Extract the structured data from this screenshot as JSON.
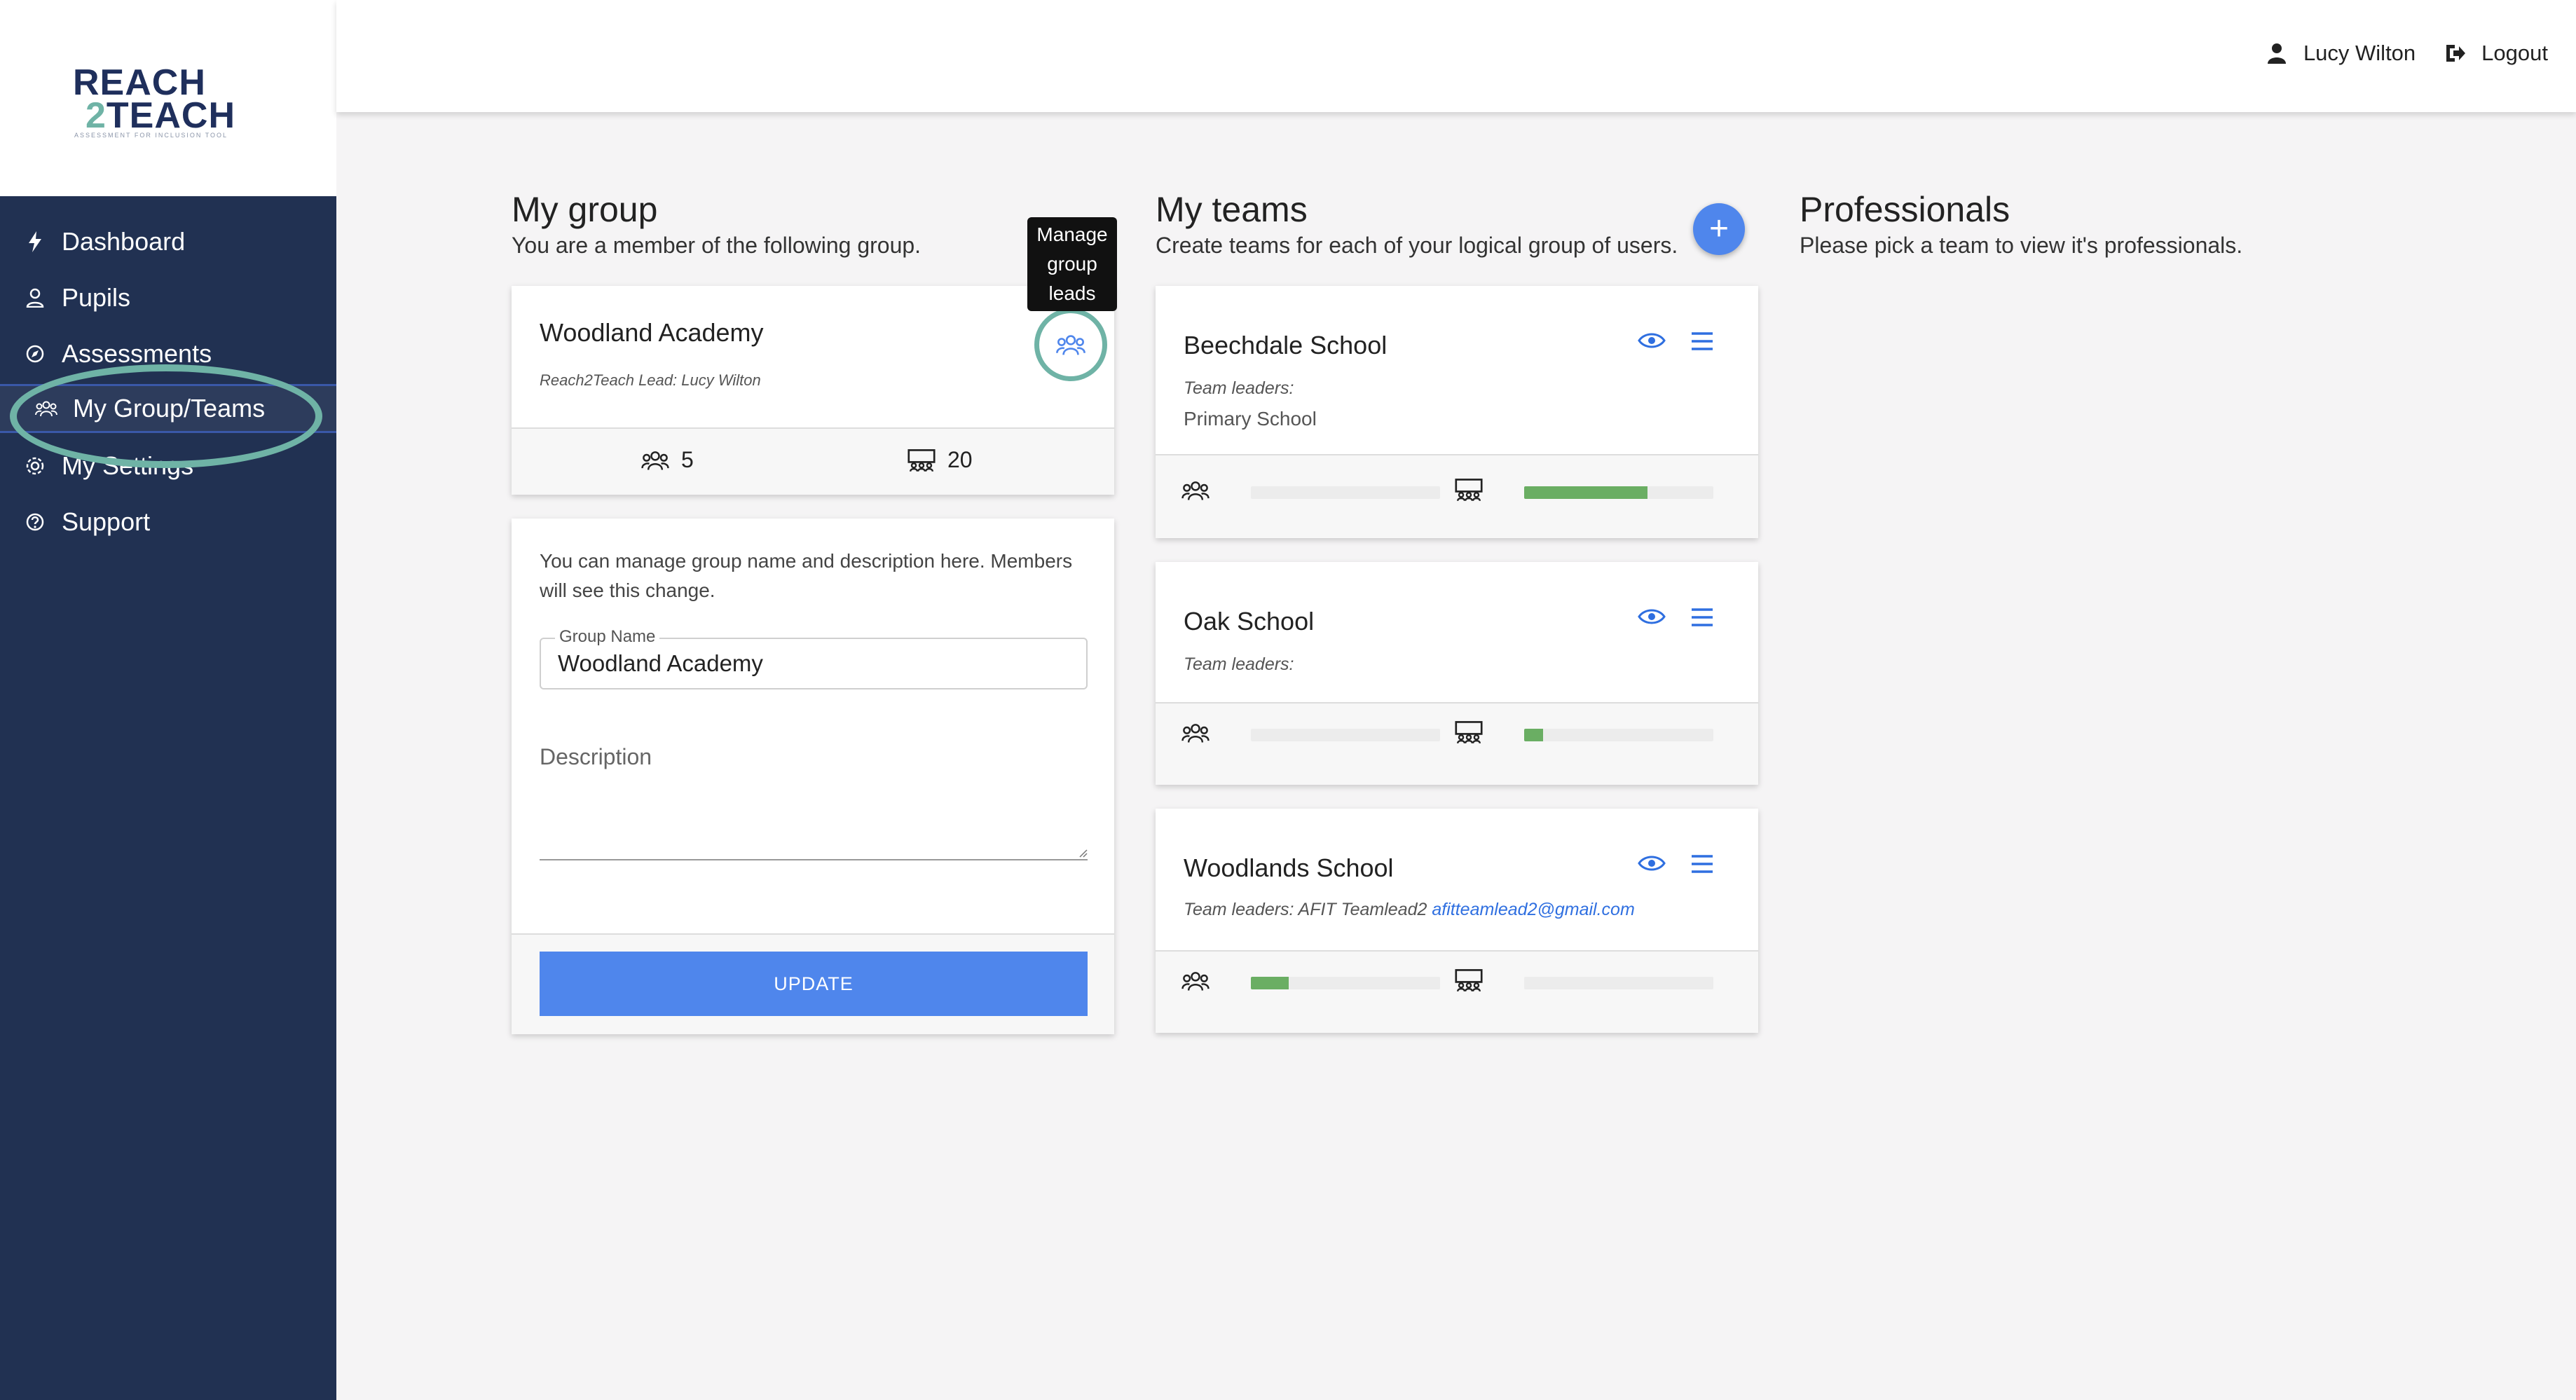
{
  "brand": {
    "line1": "REACH",
    "line2_num": "2",
    "line2": "TEACH",
    "tagline": "ASSESSMENT FOR INCLUSION TOOL"
  },
  "sidebar": {
    "items": [
      {
        "label": "Dashboard",
        "icon": "bolt-icon"
      },
      {
        "label": "Pupils",
        "icon": "person-icon"
      },
      {
        "label": "Assessments",
        "icon": "compass-icon"
      },
      {
        "label": "My Group/Teams",
        "icon": "group-icon",
        "active": true
      },
      {
        "label": "My Settings",
        "icon": "gear-icon"
      },
      {
        "label": "Support",
        "icon": "help-icon"
      }
    ]
  },
  "header": {
    "user_name": "Lucy Wilton",
    "logout_label": "Logout"
  },
  "my_group": {
    "title": "My group",
    "subtitle": "You are a member of the following group.",
    "card": {
      "name": "Woodland Academy",
      "lead": "Reach2Teach Lead: Lucy Wilton",
      "tooltip": [
        "Manage",
        "group",
        "leads"
      ],
      "members_count": "5",
      "pupils_count": "20"
    },
    "edit": {
      "description": "You can manage group name and description here. Members will see this change.",
      "group_name_label": "Group Name",
      "group_name_value": "Woodland Academy",
      "description_label": "Description",
      "update_label": "UPDATE"
    }
  },
  "my_teams": {
    "title": "My teams",
    "subtitle": "Create teams for each of your logical group of users.",
    "add_label": "+",
    "teams": [
      {
        "name": "Beechdale School",
        "leaders_label": "Team leaders:",
        "leader_name": "",
        "leader_email": "",
        "school": "Primary School",
        "members_progress": 0,
        "pupils_progress": 0.65
      },
      {
        "name": "Oak School",
        "leaders_label": "Team leaders:",
        "leader_name": "",
        "leader_email": "",
        "school": "",
        "members_progress": 0,
        "pupils_progress": 0.1
      },
      {
        "name": "Woodlands School",
        "leaders_label": "Team leaders:",
        "leader_name": "AFIT Teamlead2",
        "leader_email": "afitteamlead2@gmail.com",
        "school": "",
        "members_progress": 0.2,
        "pupils_progress": 0
      }
    ]
  },
  "professionals": {
    "title": "Professionals",
    "subtitle": "Please pick a team to view it's professionals."
  },
  "colors": {
    "sidebar_bg": "#213152",
    "accent_blue": "#4f86ec",
    "highlight_teal": "#6fb3a6",
    "progress_green": "#6aae63"
  }
}
